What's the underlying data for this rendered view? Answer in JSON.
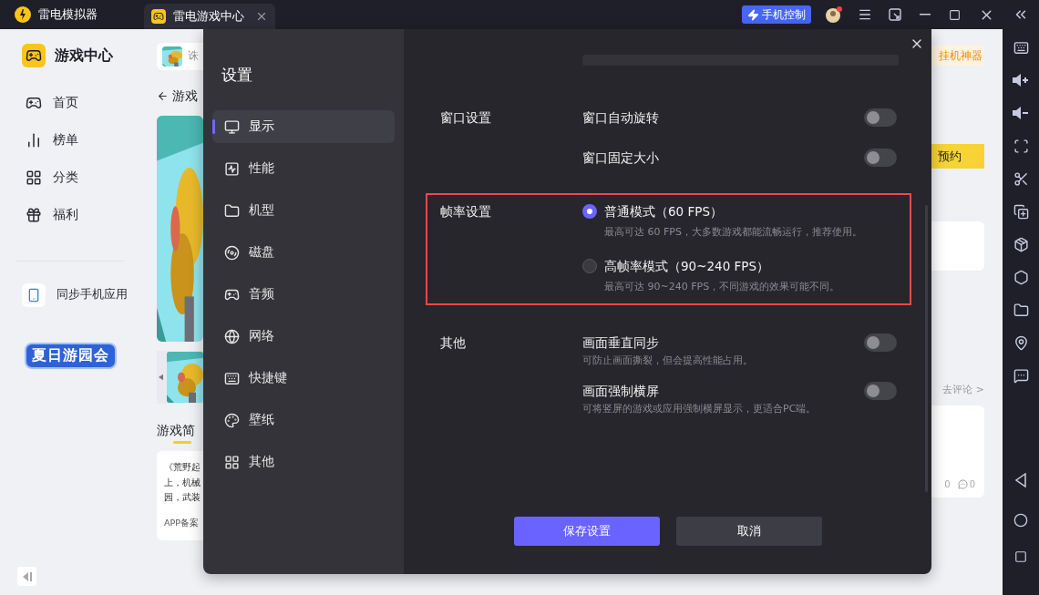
{
  "titlebar": {
    "app_name": "雷电模拟器",
    "tabs": [
      {
        "label": "雷电游戏中心",
        "selected": true
      }
    ],
    "phone_control": "手机控制",
    "notification": true
  },
  "sidebar": {
    "title": "游戏中心",
    "items": [
      {
        "label": "首页"
      },
      {
        "label": "榜单"
      },
      {
        "label": "分类"
      },
      {
        "label": "福利"
      }
    ],
    "sync": "同步手机应用",
    "banner": "夏日游园会"
  },
  "page_behind": {
    "search_value": "诛",
    "back_title": "游戏",
    "section_title": "游戏简",
    "intro_lines": [
      "《荒野起",
      "上，机械",
      "园，武装"
    ],
    "filing": "APP备案",
    "tag": "挂机神器",
    "reserve_button": "预约",
    "comment_link": "去评论 >",
    "like_count": "0",
    "comment_count": "0"
  },
  "settings": {
    "title": "设置",
    "nav": [
      {
        "label": "显示",
        "selected": true
      },
      {
        "label": "性能",
        "selected": false
      },
      {
        "label": "机型",
        "selected": false
      },
      {
        "label": "磁盘",
        "selected": false
      },
      {
        "label": "音频",
        "selected": false
      },
      {
        "label": "网络",
        "selected": false
      },
      {
        "label": "快捷键",
        "selected": false
      },
      {
        "label": "壁纸",
        "selected": false
      },
      {
        "label": "其他",
        "selected": false
      }
    ],
    "sections": [
      {
        "label": "窗口设置",
        "kind": "toggles",
        "highlighted": false,
        "items": [
          {
            "label": "窗口自动旋转",
            "on": false
          },
          {
            "label": "窗口固定大小",
            "on": false
          }
        ]
      },
      {
        "label": "帧率设置",
        "kind": "radios",
        "highlighted": true,
        "items": [
          {
            "label": "普通模式（60 FPS）",
            "description": "最高可达 60 FPS，大多数游戏都能流畅运行，推荐使用。",
            "selected": true
          },
          {
            "label": "高帧率模式（90~240 FPS）",
            "description": "最高可达 90~240 FPS，不同游戏的效果可能不同。",
            "selected": false
          }
        ]
      },
      {
        "label": "其他",
        "kind": "toggles",
        "highlighted": false,
        "items": [
          {
            "label": "画面垂直同步",
            "description": "可防止画面撕裂，但会提高性能占用。",
            "on": false
          },
          {
            "label": "画面强制横屏",
            "description": "可将竖屏的游戏或应用强制横屏显示，更适合PC端。",
            "on": false
          }
        ]
      }
    ],
    "buttons": {
      "save": "保存设置",
      "cancel": "取消"
    }
  }
}
